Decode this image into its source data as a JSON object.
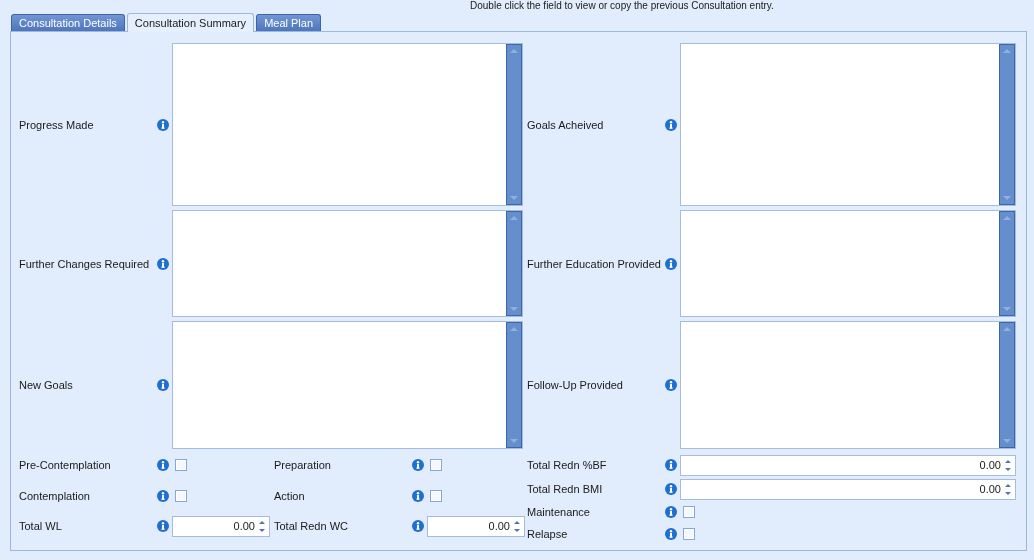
{
  "hint": "Double click the field to view or copy the previous Consultation entry.",
  "tabs": [
    {
      "label": "Consultation Details",
      "selected": false
    },
    {
      "label": "Consultation Summary",
      "selected": true
    },
    {
      "label": "Meal Plan",
      "selected": false
    }
  ],
  "memo_rows": [
    {
      "left": {
        "label": "Progress Made"
      },
      "right": {
        "label": "Goals Acheived"
      }
    },
    {
      "left": {
        "label": "Further Changes Required"
      },
      "right": {
        "label": "Further Education Provided"
      }
    },
    {
      "left": {
        "label": "New Goals"
      },
      "right": {
        "label": "Follow-Up Provided"
      }
    }
  ],
  "left_fields": [
    {
      "kind": "checkbox",
      "label": "Pre-Contemplation",
      "checked": false
    },
    {
      "kind": "checkbox",
      "label": "Preparation",
      "checked": false
    },
    {
      "kind": "checkbox",
      "label": "Contemplation",
      "checked": false
    },
    {
      "kind": "checkbox",
      "label": "Action",
      "checked": false
    },
    {
      "kind": "number",
      "label": "Total WL",
      "value": "0.00"
    },
    {
      "kind": "number",
      "label": "Total Redn WC",
      "value": "0.00"
    }
  ],
  "right_fields": [
    {
      "kind": "number",
      "label": "Total Redn %BF",
      "value": "0.00"
    },
    {
      "kind": "number",
      "label": "Total Redn BMI",
      "value": "0.00"
    },
    {
      "kind": "checkbox",
      "label": "Maintenance",
      "checked": false
    },
    {
      "kind": "checkbox",
      "label": "Relapse",
      "checked": false
    }
  ]
}
